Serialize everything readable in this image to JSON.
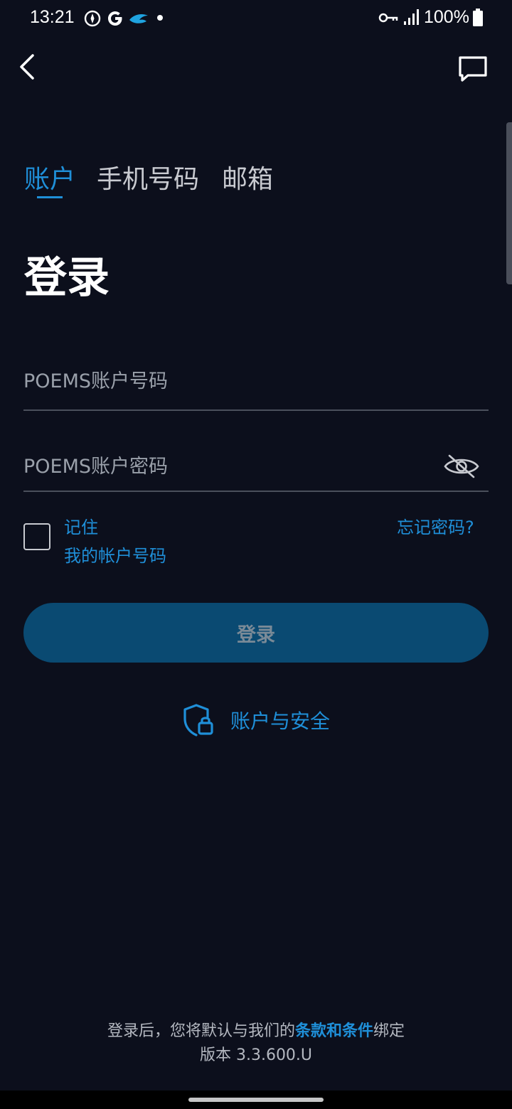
{
  "status_bar": {
    "time": "13:21",
    "battery": "100%",
    "icons": [
      "compass-icon",
      "google-icon",
      "bird-icon",
      "dot-icon",
      "key-icon",
      "signal-icon",
      "battery-icon"
    ]
  },
  "header": {
    "back_icon": "chevron-left-icon",
    "chat_icon": "chat-bubble-icon"
  },
  "tabs": [
    {
      "label": "账户",
      "active": true
    },
    {
      "label": "手机号码",
      "active": false
    },
    {
      "label": "邮箱",
      "active": false
    }
  ],
  "page_title": "登录",
  "form": {
    "account_placeholder": "POEMS账户号码",
    "password_placeholder": "POEMS账户密码",
    "remember_line1": "记住",
    "remember_line2": "我的帐户号码",
    "forgot_label": "忘记密码?",
    "login_label": "登录"
  },
  "security_label": "账户与安全",
  "footer": {
    "prefix": "登录后，您将默认与我们的",
    "terms": "条款和条件",
    "suffix": "绑定",
    "version": "版本 3.3.600.U"
  },
  "colors": {
    "background": "#0c0f1c",
    "accent": "#1f8fd8",
    "button": "#0a4a72"
  }
}
